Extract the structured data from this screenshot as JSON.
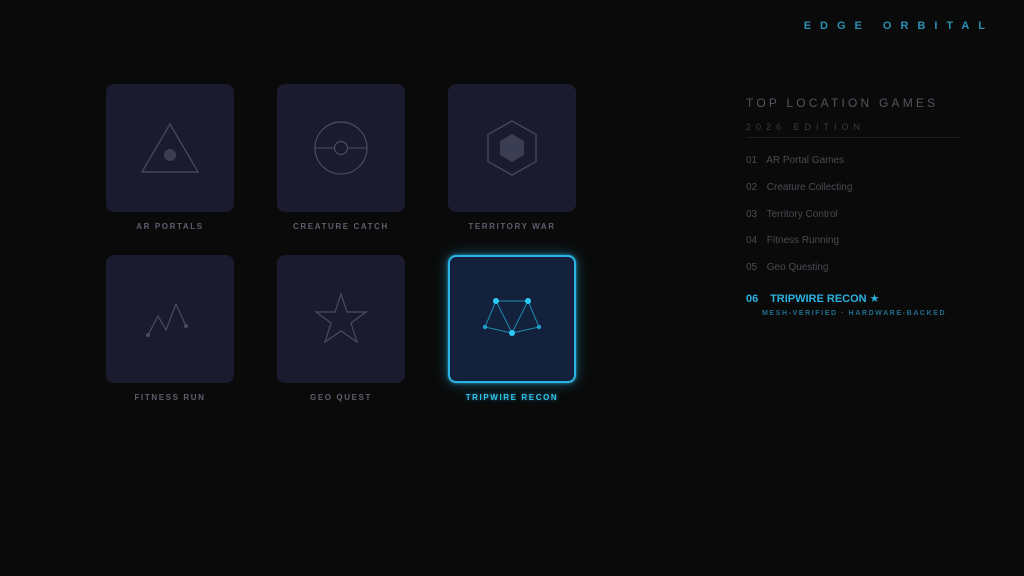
{
  "brand": "EDGE ORBITAL",
  "tiles": [
    {
      "label": "AR PORTALS",
      "icon": "triangle-portal-icon",
      "active": false
    },
    {
      "label": "CREATURE CATCH",
      "icon": "capture-orb-icon",
      "active": false
    },
    {
      "label": "TERRITORY WAR",
      "icon": "hexagon-icon",
      "active": false
    },
    {
      "label": "FITNESS RUN",
      "icon": "run-route-icon",
      "active": false
    },
    {
      "label": "GEO QUEST",
      "icon": "star-icon",
      "active": false
    },
    {
      "label": "TRIPWIRE RECON",
      "icon": "mesh-network-icon",
      "active": true
    }
  ],
  "panel": {
    "title": "TOP LOCATION GAMES",
    "subtitle": "2026 EDITION",
    "items": [
      {
        "num": "01",
        "name": "AR Portal Games"
      },
      {
        "num": "02",
        "name": "Creature Collecting"
      },
      {
        "num": "03",
        "name": "Territory Control"
      },
      {
        "num": "04",
        "name": "Fitness Running"
      },
      {
        "num": "05",
        "name": "Geo Questing"
      }
    ],
    "featured": {
      "num": "06",
      "name": "TRIPWIRE RECON ★",
      "note": "MESH-VERIFIED · HARDWARE-BACKED"
    }
  },
  "colors": {
    "background": "#0a0a0a",
    "tile": "#1a1b2e",
    "tile_active": "#14213d",
    "accent": "#2bb4e3",
    "icon_stroke": "#4a4c62"
  }
}
